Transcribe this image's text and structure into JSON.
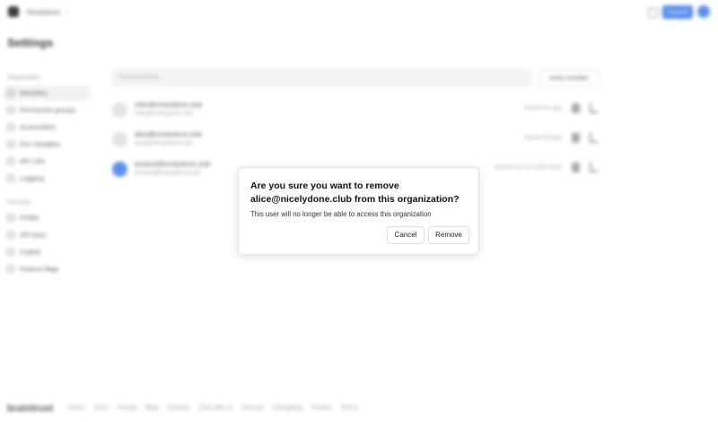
{
  "header": {
    "org_name": "Nicelydone",
    "upgrade_label": "Upgrade"
  },
  "page": {
    "title": "Settings"
  },
  "sidebar": {
    "sections": [
      {
        "label": "Organization",
        "items": [
          "Members",
          "Permission groups",
          "AI providers",
          "Env variables",
          "API URL",
          "Logging"
        ]
      },
      {
        "label": "Personal",
        "items": [
          "Profile",
          "API keys",
          "Copilot",
          "Feature flags"
        ]
      }
    ]
  },
  "members": {
    "search_placeholder": "Find members",
    "invite_label": "Invite member",
    "rows": [
      {
        "email": "mike@nicelydone.club",
        "sub": "mike@nicelydone.club",
        "joined": "Joined 4m ago"
      },
      {
        "email": "alice@nicelydone.club",
        "sub": "alice@nicelydone.club",
        "joined": "Joined 4m ago"
      },
      {
        "email": "product@nicelydone.club",
        "sub": "product@nicelydone.club",
        "joined": "Joined Nov 18 2025 09:00"
      }
    ]
  },
  "footer": {
    "brand": "braintrust",
    "links": [
      "Home",
      "Docs",
      "Pricing",
      "Blog",
      "Careers",
      "Chat with us",
      "Discord",
      "Changelog",
      "Privacy",
      "Terms"
    ]
  },
  "dialog": {
    "title": "Are you sure you want to remove alice@nicelydone.club from this organization?",
    "description": "This user will no longer be able to access this organization",
    "cancel_label": "Cancel",
    "remove_label": "Remove"
  }
}
